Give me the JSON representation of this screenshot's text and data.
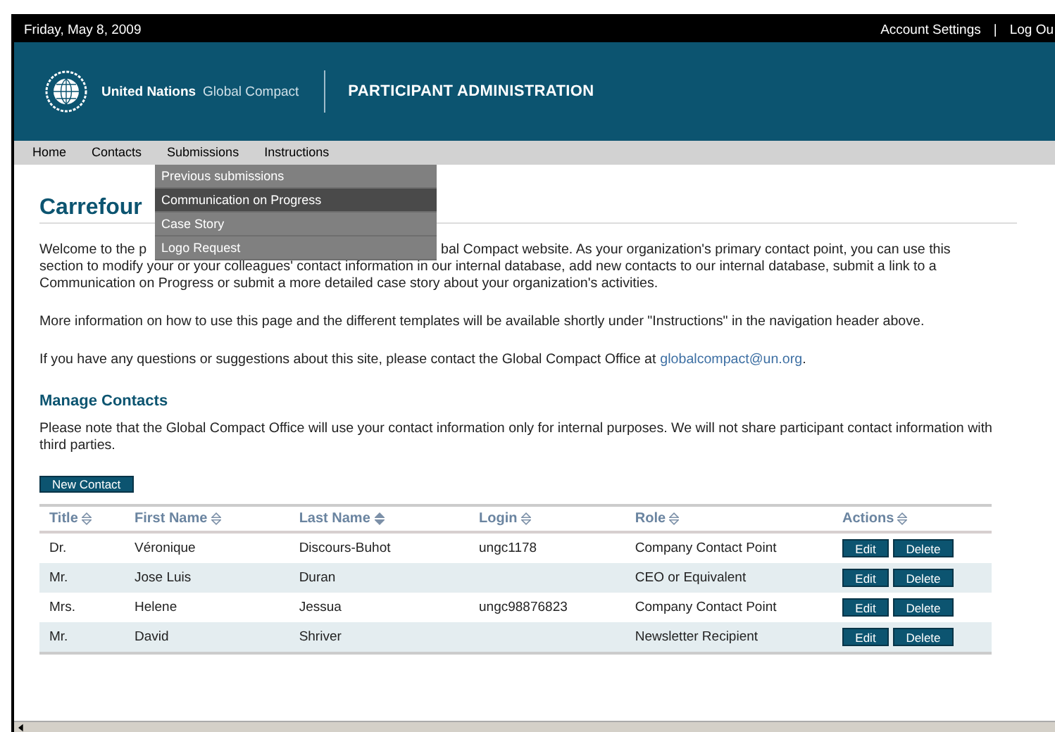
{
  "top_bar": {
    "date": "Friday, May 8, 2009",
    "links": [
      "Account Settings",
      "Log Ou"
    ],
    "separator": "|"
  },
  "header": {
    "brand_bold": "United Nations",
    "brand_light": "Global Compact",
    "title": "PARTICIPANT ADMINISTRATION"
  },
  "nav": {
    "items": [
      {
        "label": "Home"
      },
      {
        "label": "Contacts"
      },
      {
        "label": "Submissions",
        "menu": [
          {
            "label": "Previous submissions",
            "selected": false
          },
          {
            "label": "Communication on Progress",
            "selected": true
          },
          {
            "label": "Case Story",
            "selected": false
          },
          {
            "label": "Logo Request",
            "selected": false
          }
        ]
      },
      {
        "label": "Instructions"
      }
    ]
  },
  "page_title": "Carrefour",
  "intro": {
    "line1_start": "Welcome to the p",
    "line1_end": "bal Compact website. As your organization's primary contact point, you can use this",
    "rest": "section to modify your or your colleagues' contact information in our internal database, add new contacts to our internal database, submit a link to a Communication on Progress or submit a more detailed case story about your organization's activities."
  },
  "info": "More information on how to use this page and the different templates will be available shortly under \"Instructions\" in the navigation header above.",
  "contact_text": "If you have any questions or suggestions about this site, please contact the Global Compact Office at",
  "contact_email": "globalcompact@un.org",
  "contact_end": ".",
  "section_title": "Manage Contacts",
  "note": "Please note that the Global Compact Office will use your contact information only for internal purposes. We will not share participant contact information with third parties.",
  "new_button": "New Contact",
  "table": {
    "columns": [
      {
        "label": "Title",
        "sorted": false
      },
      {
        "label": "First Name",
        "sorted": false
      },
      {
        "label": "Last Name",
        "sorted": true
      },
      {
        "label": "Login",
        "sorted": false
      },
      {
        "label": "Role",
        "sorted": false
      },
      {
        "label": "Actions",
        "sorted": false
      }
    ],
    "rows": [
      {
        "cells": [
          "Dr.",
          "Véronique",
          "Discours-Buhot",
          "ungc1178",
          "Company Contact Point"
        ],
        "actions": [
          "Edit",
          "Delete"
        ]
      },
      {
        "cells": [
          "Mr.",
          "Jose Luis",
          "Duran",
          "",
          "CEO or Equivalent"
        ],
        "actions": [
          "Edit",
          "Delete"
        ]
      },
      {
        "cells": [
          "Mrs.",
          "Helene",
          "Jessua",
          "ungc98876823",
          "Company Contact Point"
        ],
        "actions": [
          "Edit",
          "Delete"
        ]
      },
      {
        "cells": [
          "Mr.",
          "David",
          "Shriver",
          "",
          "Newsletter Recipient"
        ],
        "actions": [
          "Edit",
          "Delete"
        ]
      }
    ]
  }
}
